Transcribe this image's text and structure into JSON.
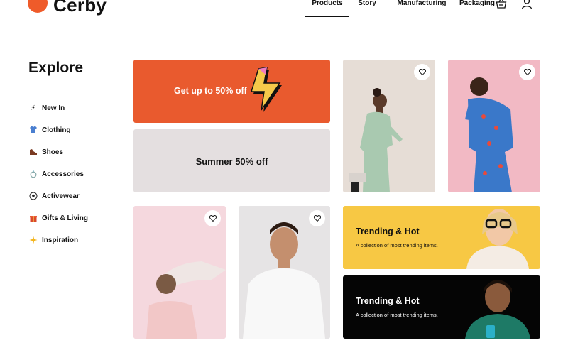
{
  "brand": {
    "name": "Cerby",
    "colors": {
      "orange": "#ef5b2a",
      "yellow": "#f7c53b"
    }
  },
  "nav": {
    "items": [
      {
        "label": "Products",
        "active": true
      },
      {
        "label": "Story",
        "active": false
      },
      {
        "label": "Manufacturing",
        "active": false
      },
      {
        "label": "Packaging",
        "active": false
      }
    ],
    "icons": [
      "basket-icon",
      "user-icon"
    ]
  },
  "sidebar": {
    "title": "Explore",
    "items": [
      {
        "label": "New In",
        "icon": "lightning-icon"
      },
      {
        "label": "Clothing",
        "icon": "shirt-icon"
      },
      {
        "label": "Shoes",
        "icon": "shoe-icon"
      },
      {
        "label": "Accessories",
        "icon": "ring-icon"
      },
      {
        "label": "Activewear",
        "icon": "ball-icon"
      },
      {
        "label": "Gifts & Living",
        "icon": "gift-icon"
      },
      {
        "label": "Inspiration",
        "icon": "sparkle-icon"
      }
    ]
  },
  "promos": {
    "discount": {
      "text": "Get up to 50% off",
      "color": "#e95a2e"
    },
    "summer": {
      "text": "Summer 50% off",
      "color": "#e4dfe0"
    }
  },
  "trending": [
    {
      "title": "Trending & Hot",
      "subtitle": "A collection of most trending items.",
      "color": "#f7c844"
    },
    {
      "title": "Trending & Hot",
      "subtitle": "A collection of most trending items.",
      "color": "#050505"
    }
  ]
}
